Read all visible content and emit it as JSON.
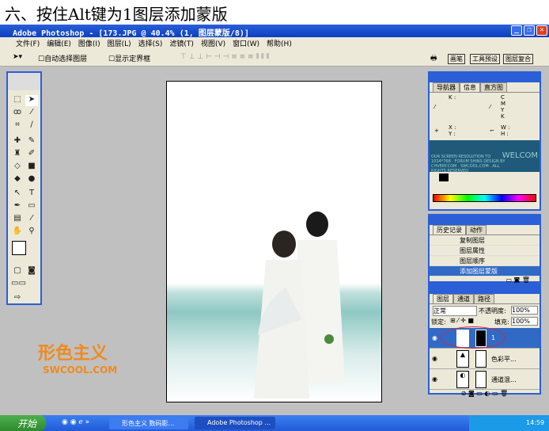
{
  "caption": "六、按住Alt键为1图层添加蒙版",
  "window": {
    "title": "Adobe Photoshop - [173.JPG @ 40.4% (1, 图层蒙版/8)]"
  },
  "menu": [
    "文件(F)",
    "编辑(E)",
    "图像(I)",
    "图层(L)",
    "选择(S)",
    "滤镜(T)",
    "视图(V)",
    "窗口(W)",
    "帮助(H)"
  ],
  "options": {
    "auto_select": "自动选择图层",
    "show_bounds": "显示定界框",
    "palette_tabs": [
      "画笔",
      "工具预设",
      "图层复合"
    ]
  },
  "navigator": {
    "tabs": [
      "导航器",
      "信息",
      "直方图"
    ],
    "active": 1,
    "k": "K :",
    "cmyk": "C\nM\nY\nK",
    "xy": "X :\nY :",
    "wh": "W :\nH :",
    "banner": "OUR SCREEN RESOLUTION TO 1024*768 · FORUM SHINS DESIGN BY CHVERY.COM · SWCOOL.COM . ALL RIGHTS RESERVED",
    "banner_word": "WELCOM"
  },
  "history": {
    "tabs": [
      "历史记录",
      "动作"
    ],
    "items": [
      "复制图层",
      "图层属性",
      "图层顺序",
      "添加图层蒙版"
    ],
    "selected": 3
  },
  "layers": {
    "tabs": [
      "图层",
      "通道",
      "路径"
    ],
    "blend": "正常",
    "opacity_label": "不透明度:",
    "opacity": "100%",
    "lock_label": "锁定:",
    "fill_label": "填充:",
    "fill": "100%",
    "items": [
      "1",
      "色彩平...",
      "通道混..."
    ],
    "selected": 0
  },
  "watermark": {
    "cn": "形色主义",
    "en": "SWCOOL.COM",
    "color": "#f08a1c"
  },
  "taskbar": {
    "start": "开始",
    "tasks": [
      "形色主义 数码影...",
      "Adobe Photoshop ..."
    ],
    "time": "14:59"
  }
}
